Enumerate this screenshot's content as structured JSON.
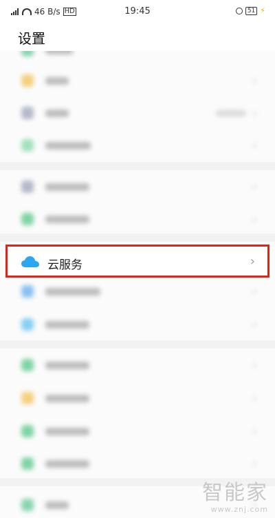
{
  "status_bar": {
    "network_speed": "46 B/s",
    "time": "19:45",
    "battery": "51",
    "hd_label": "HD"
  },
  "header": {
    "title": "设置"
  },
  "highlighted_item": {
    "label": "云服务",
    "icon": "cloud-icon"
  },
  "blurred_items": [
    {
      "icon_color": "#4cc08a"
    },
    {
      "icon_color": "#f2b93b"
    },
    {
      "icon_color": "#8e95b0"
    },
    {
      "icon_color": "#74d39a"
    },
    {
      "icon_color": "#8e95b0"
    },
    {
      "icon_color": "#3fbf76"
    },
    {
      "icon_color": "#4aa3f0"
    },
    {
      "icon_color": "#46b8f0"
    },
    {
      "icon_color": "#3fbf76"
    },
    {
      "icon_color": "#f2b93b"
    },
    {
      "icon_color": "#3fbf76"
    },
    {
      "icon_color": "#3fbf76"
    }
  ],
  "colors": {
    "highlight_border": "#e2231a",
    "cloud_icon": "#2aa7f0"
  },
  "watermark": {
    "big": "智能家",
    "small": "www.znj.com"
  }
}
